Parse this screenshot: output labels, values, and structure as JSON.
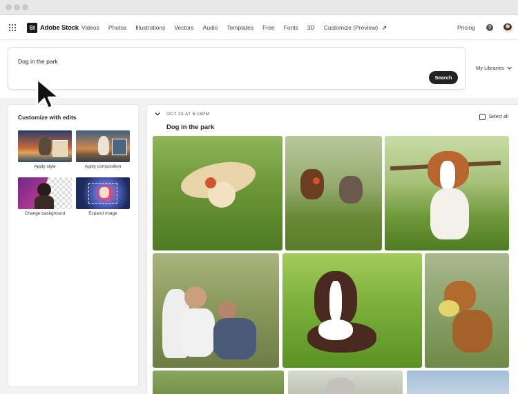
{
  "app": {
    "logo_mark": "St",
    "name": "Adobe Stock"
  },
  "nav": {
    "items": [
      "Videos",
      "Photos",
      "Illustrations",
      "Vectors",
      "Audio",
      "Templates",
      "Free",
      "Fonts",
      "3D",
      "Customize (Preview)"
    ],
    "pricing": "Pricing",
    "help_glyph": "?"
  },
  "search": {
    "query": "Dog in the park",
    "button": "Search",
    "libraries": "My Libraries"
  },
  "customize": {
    "title": "Customize with edits",
    "tiles": [
      {
        "label": "Apply style"
      },
      {
        "label": "Apply composition"
      },
      {
        "label": "Change background"
      },
      {
        "label": "Expand image"
      }
    ]
  },
  "results": {
    "date": "OCT 23 AT 6:16PM",
    "title": "Dog in the park",
    "select_all": "Select all"
  },
  "icons": {
    "apps": "apps-grid-icon",
    "help": "help-icon",
    "external": "external-link-icon",
    "chevron": "chevron-down-icon",
    "cursor": "arrow-cursor-icon"
  },
  "colors": {
    "button_bg": "#222222",
    "page_bg": "#f2f2f2"
  }
}
